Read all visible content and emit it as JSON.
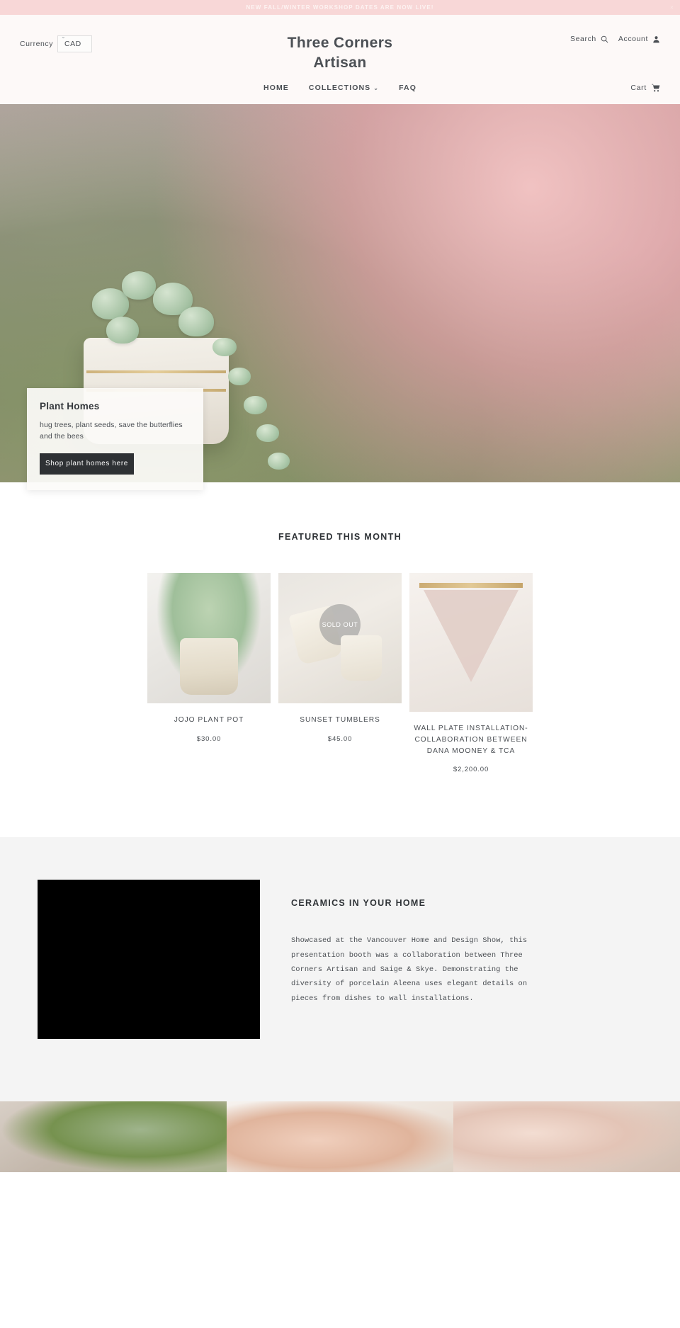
{
  "announcement": {
    "text": "NEW FALL/WINTER WORKSHOP DATES ARE NOW LIVE!",
    "close_label": "×",
    "background": "#f8d7d7"
  },
  "header": {
    "currency_label": "Currency",
    "currency_value": "CAD",
    "brand_line1": "Three Corners",
    "brand_line2": "Artisan",
    "search_label": "Search",
    "account_label": "Account",
    "cart_label": "Cart",
    "background": "#fdf9f8"
  },
  "nav": {
    "items": [
      {
        "label": "HOME",
        "has_dropdown": false
      },
      {
        "label": "COLLECTIONS",
        "has_dropdown": true
      },
      {
        "label": "FAQ",
        "has_dropdown": false
      }
    ],
    "caret": "⌄"
  },
  "hero": {
    "card_title": "Plant Homes",
    "card_text": "hug trees, plant seeds, save the butterflies and the bees",
    "button_label": "Shop plant homes here",
    "button_color": "#2e3134"
  },
  "featured": {
    "title": "FEATURED THIS MONTH",
    "products": [
      {
        "title": "JOJO PLANT POT",
        "price": "$30.00",
        "sold_out": false,
        "badge": ""
      },
      {
        "title": "SUNSET TUMBLERS",
        "price": "$45.00",
        "sold_out": true,
        "badge": "SOLD OUT"
      },
      {
        "title": "WALL PLATE INSTALLATION-COLLABORATION BETWEEN DANA MOONEY & TCA",
        "price": "$2,200.00",
        "sold_out": false,
        "badge": ""
      }
    ]
  },
  "feature_section": {
    "title": "CERAMICS IN YOUR HOME",
    "body": "Showcased at the Vancouver Home and Design Show, this presentation booth was a collaboration between Three Corners Artisan and Saige & Skye. Demonstrating the diversity of porcelain Aleena uses elegant details on pieces from dishes to wall installations.",
    "background": "#f4f4f4"
  }
}
